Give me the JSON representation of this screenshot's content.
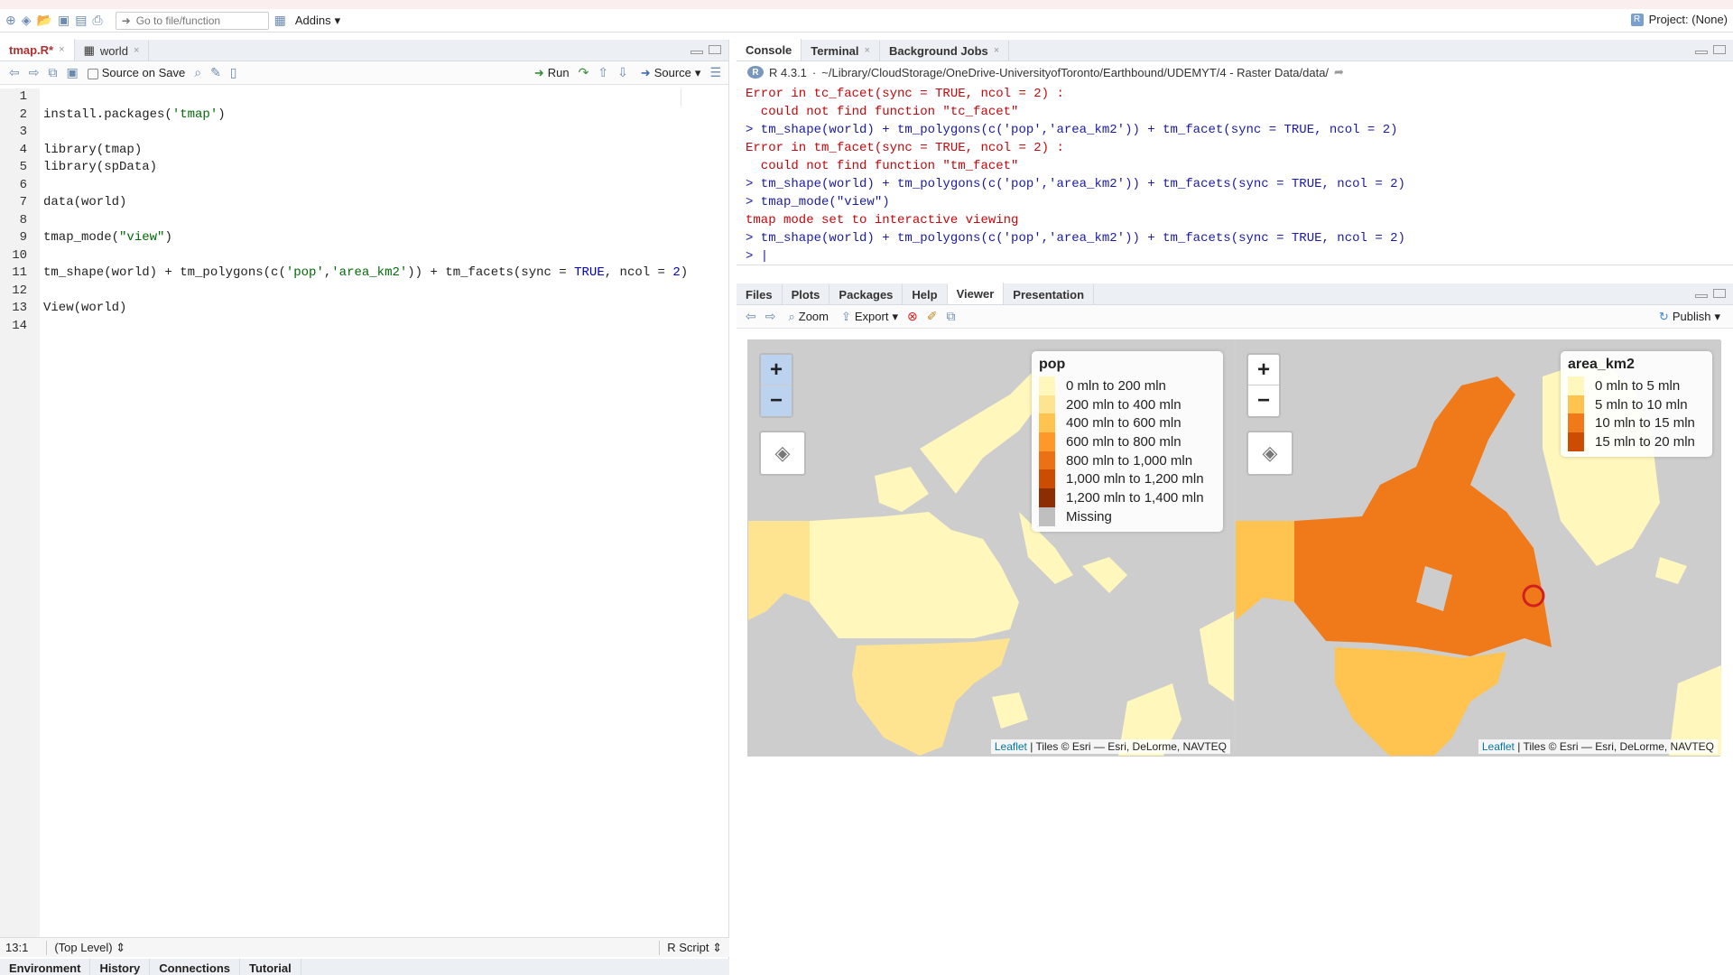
{
  "toolbar": {
    "goto_placeholder": "Go to file/function",
    "addins": "Addins",
    "project": "Project: (None)"
  },
  "editor": {
    "tabs": [
      {
        "label": "tmap.R*"
      },
      {
        "label": "world"
      }
    ],
    "source_on_save": "Source on Save",
    "run": "Run",
    "source": "Source",
    "lines": [
      {
        "n": "1",
        "html": ""
      },
      {
        "n": "2",
        "html": "install.packages(<span class='str'>'tmap'</span>)"
      },
      {
        "n": "3",
        "html": ""
      },
      {
        "n": "4",
        "html": "library(tmap)"
      },
      {
        "n": "5",
        "html": "library(spData)"
      },
      {
        "n": "6",
        "html": ""
      },
      {
        "n": "7",
        "html": "data(world)"
      },
      {
        "n": "8",
        "html": ""
      },
      {
        "n": "9",
        "html": "tmap_mode(<span class='str'>\"view\"</span>)"
      },
      {
        "n": "10",
        "html": ""
      },
      {
        "n": "11",
        "html": "tm_shape(world) + tm_polygons(c(<span class='str'>'pop'</span>,<span class='str'>'area_km2'</span>)) + tm_facets(sync = <span class='num'>TRUE</span>, ncol = <span class='num'>2</span>)"
      },
      {
        "n": "12",
        "html": ""
      },
      {
        "n": "13",
        "html": "View(world)"
      },
      {
        "n": "14",
        "html": ""
      }
    ],
    "cursor": "13:1",
    "scope": "(Top Level)",
    "filetype": "R Script"
  },
  "lower_tabs": [
    "Environment",
    "History",
    "Connections",
    "Tutorial"
  ],
  "console": {
    "tabs": [
      {
        "label": "Console"
      },
      {
        "label": "Terminal"
      },
      {
        "label": "Background Jobs"
      }
    ],
    "version": "R 4.3.1",
    "path": "~/Library/CloudStorage/OneDrive-UniversityofToronto/Earthbound/UDEMYT/4 - Raster Data/data/",
    "lines": [
      {
        "cls": "err",
        "text": "Error in tc_facet(sync = TRUE, ncol = 2) :"
      },
      {
        "cls": "err",
        "text": "  could not find function \"tc_facet\""
      },
      {
        "cls": "cmd",
        "text": "> tm_shape(world) + tm_polygons(c('pop','area_km2')) + tm_facet(sync = TRUE, ncol = 2)"
      },
      {
        "cls": "err",
        "text": "Error in tm_facet(sync = TRUE, ncol = 2) :"
      },
      {
        "cls": "err",
        "text": "  could not find function \"tm_facet\""
      },
      {
        "cls": "cmd",
        "text": "> tm_shape(world) + tm_polygons(c('pop','area_km2')) + tm_facets(sync = TRUE, ncol = 2)"
      },
      {
        "cls": "cmd",
        "text": "> tmap_mode(\"view\")"
      },
      {
        "cls": "err",
        "text": "tmap mode set to interactive viewing"
      },
      {
        "cls": "cmd",
        "text": "> tm_shape(world) + tm_polygons(c('pop','area_km2')) + tm_facets(sync = TRUE, ncol = 2)"
      },
      {
        "cls": "cmd",
        "text": "> |"
      }
    ]
  },
  "viewer": {
    "tabs": [
      {
        "label": "Files"
      },
      {
        "label": "Plots"
      },
      {
        "label": "Packages"
      },
      {
        "label": "Help"
      },
      {
        "label": "Viewer"
      },
      {
        "label": "Presentation"
      }
    ],
    "zoom": "Zoom",
    "export": "Export",
    "publish": "Publish",
    "attribution_link": "Leaflet",
    "attribution_text": "| Tiles © Esri — Esri, DeLorme, NAVTEQ",
    "pop_legend": {
      "title": "pop",
      "items": [
        {
          "label": "0 mln to 200 mln",
          "color": "#fff7bc"
        },
        {
          "label": "200 mln to 400 mln",
          "color": "#fee391"
        },
        {
          "label": "400 mln to 600 mln",
          "color": "#fec44f"
        },
        {
          "label": "600 mln to 800 mln",
          "color": "#fe9929"
        },
        {
          "label": "800 mln to 1,000 mln",
          "color": "#ec7014"
        },
        {
          "label": "1,000 mln to 1,200 mln",
          "color": "#cc4c02"
        },
        {
          "label": "1,200 mln to 1,400 mln",
          "color": "#8c2d04"
        },
        {
          "label": "Missing",
          "color": "#bfbfbf"
        }
      ]
    },
    "area_legend": {
      "title": "area_km2",
      "items": [
        {
          "label": "0 mln to 5 mln",
          "color": "#fff7bc"
        },
        {
          "label": "5 mln to 10 mln",
          "color": "#fec44f"
        },
        {
          "label": "10 mln to 15 mln",
          "color": "#f07a1a"
        },
        {
          "label": "15 mln to 20 mln",
          "color": "#cc4c02"
        }
      ]
    }
  }
}
